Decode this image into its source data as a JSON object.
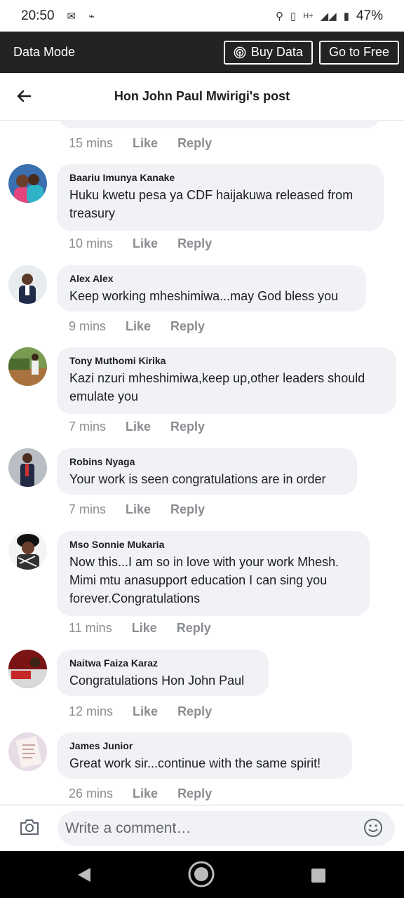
{
  "status_bar": {
    "time": "20:50",
    "network": "H+",
    "battery": "47%"
  },
  "data_mode": {
    "title": "Data Mode",
    "buy_data": "Buy Data",
    "go_free": "Go to Free"
  },
  "header": {
    "title": "Hon John Paul Mwirigi's post"
  },
  "prev_actions": {
    "time": "15 mins",
    "like": "Like",
    "reply": "Reply"
  },
  "comments": [
    {
      "name": "Baariu Imunya Kanake",
      "lines": [
        "Huku kwetu pesa ya CDF haijakuwa  released from",
        "treasury"
      ],
      "time": "10 mins",
      "like": "Like",
      "reply": "Reply"
    },
    {
      "name": "Alex Alex",
      "lines": [
        "Keep working mheshimiwa...may God bless you"
      ],
      "time": "9 mins",
      "like": "Like",
      "reply": "Reply"
    },
    {
      "name": "Tony Muthomi Kirika",
      "lines": [
        "Kazi nzuri mheshimiwa,keep up,other leaders should",
        "emulate you"
      ],
      "time": "7 mins",
      "like": "Like",
      "reply": "Reply"
    },
    {
      "name": "Robins Nyaga",
      "lines": [
        "Your work is seen congratulations are in order"
      ],
      "time": "7 mins",
      "like": "Like",
      "reply": "Reply"
    },
    {
      "name": "Mso Sonnie Mukaria",
      "lines": [
        "Now this...I am so in love with your work Mhesh.",
        "Mimi mtu anasupport education I can sing you",
        "forever.Congratulations"
      ],
      "time": "11 mins",
      "like": "Like",
      "reply": "Reply"
    },
    {
      "name": "Naitwa Faiza Karaz",
      "lines": [
        "Congratulations Hon John Paul"
      ],
      "time": "12 mins",
      "like": "Like",
      "reply": "Reply"
    },
    {
      "name": "James Junior",
      "lines": [
        "Great work sir...continue with the same spirit!"
      ],
      "time": "26 mins",
      "like": "Like",
      "reply": "Reply"
    }
  ],
  "composer": {
    "placeholder": "Write a comment…"
  },
  "colors": {
    "bubble": "#f0f2f5",
    "meta": "#8a8d91",
    "datamode_bg": "#232323"
  }
}
